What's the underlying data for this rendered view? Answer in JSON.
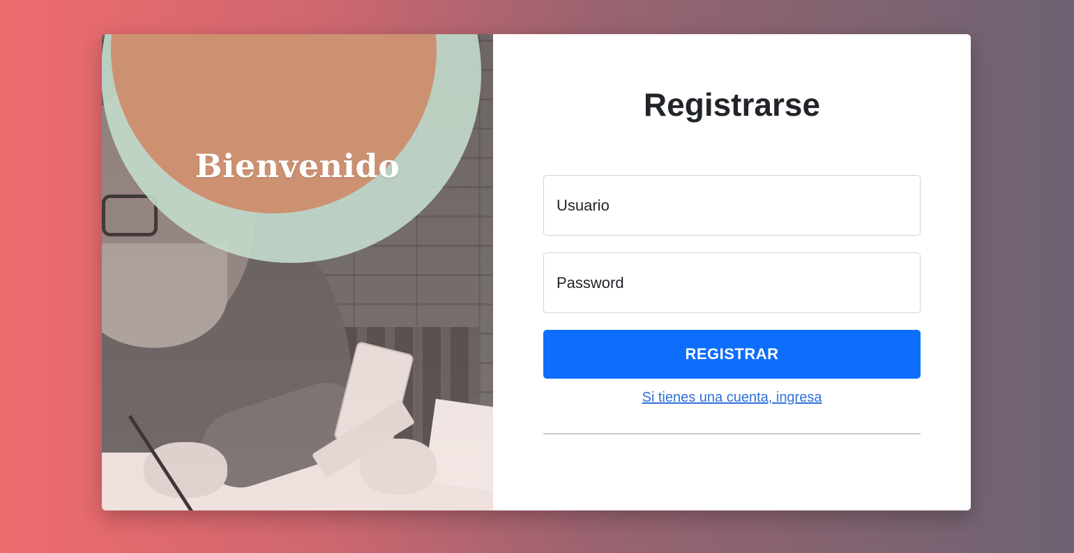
{
  "hero": {
    "welcome_text": "Bienvenido"
  },
  "form": {
    "title": "Registrarse",
    "username_placeholder": "Usuario",
    "username_value": "",
    "password_placeholder": "Password",
    "password_value": "",
    "submit_label": "REGISTRAR",
    "login_link": "Si tienes una cuenta, ingresa"
  },
  "colors": {
    "primary_button": "#0d6efd",
    "link": "#2f6fd8",
    "circle_outer": "#c5dece",
    "circle_inner": "#cd8c6a",
    "background_left": "#ee6b6e",
    "background_right": "#6c6372"
  }
}
